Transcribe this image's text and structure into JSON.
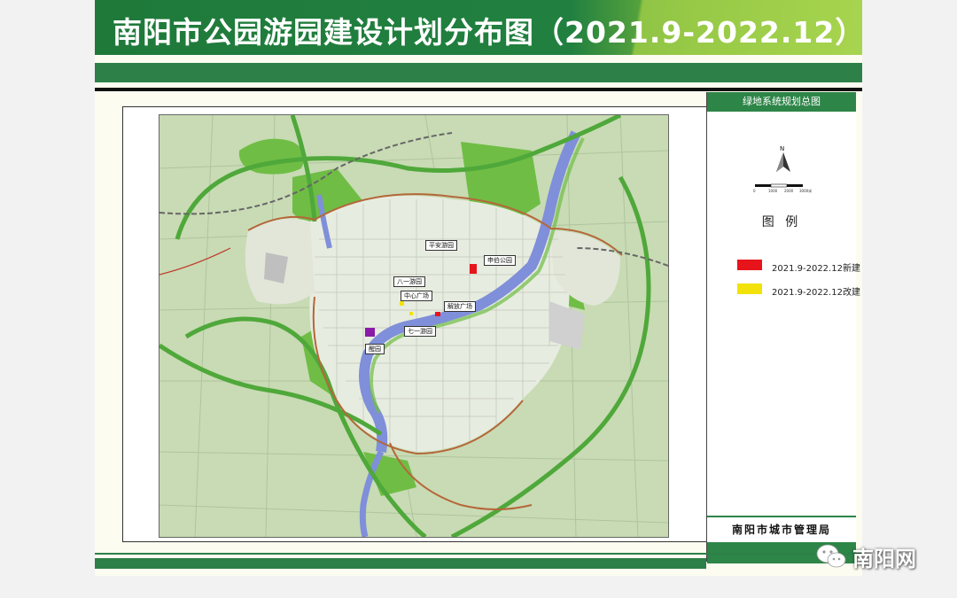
{
  "title": "南阳市公园游园建设计划分布图（2021.9-2022.12）",
  "panel": {
    "header": "绿地系统规划总图",
    "north_label": "N",
    "scale_labels": [
      "0",
      "1000",
      "2000",
      "3000米"
    ],
    "legend_title": "图 例",
    "legend": [
      {
        "label": "2021.9-2022.12新建",
        "color": "#e8141b"
      },
      {
        "label": "2021.9-2022.12改建",
        "color": "#f2e20a"
      }
    ],
    "bureau": "南阳市城市管理局"
  },
  "map": {
    "labels": [
      "平安游园",
      "申伯公园",
      "八一游园",
      "中心广场",
      "解放广场",
      "七一游园",
      "醒园"
    ],
    "colors": {
      "park_new": "#e8141b",
      "park_renovate": "#f2e20a",
      "park_purple": "#8a1aa8",
      "green": "#6fbf44",
      "river": "#7f8fd9",
      "road_border": "#b5673a"
    }
  },
  "watermark": "南阳网"
}
